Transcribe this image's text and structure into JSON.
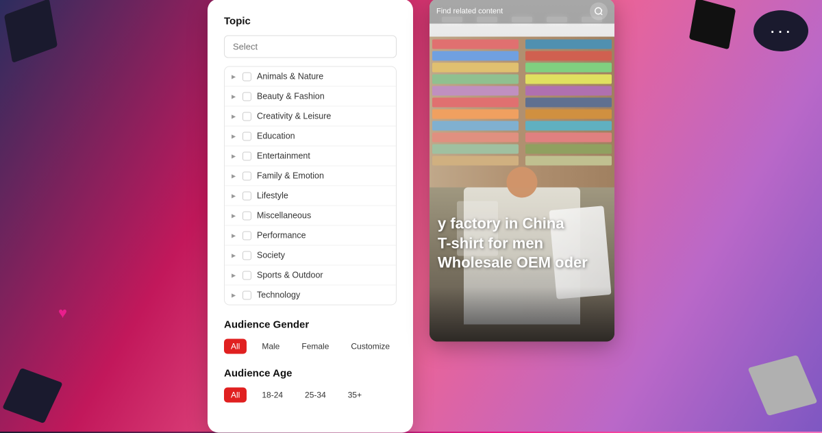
{
  "background": {
    "gradient": "linear-gradient(120deg, #2d2d5e, #c2185b, #f06292, #ba68c8, #7e57c2)"
  },
  "left_panel": {
    "topic_section": {
      "title": "Topic",
      "select_placeholder": "Select",
      "items": [
        {
          "label": "Animals & Nature",
          "checked": false
        },
        {
          "label": "Beauty & Fashion",
          "checked": false
        },
        {
          "label": "Creativity & Leisure",
          "checked": false
        },
        {
          "label": "Education",
          "checked": false
        },
        {
          "label": "Entertainment",
          "checked": false
        },
        {
          "label": "Family & Emotion",
          "checked": false
        },
        {
          "label": "Lifestyle",
          "checked": false
        },
        {
          "label": "Miscellaneous",
          "checked": false
        },
        {
          "label": "Performance",
          "checked": false
        },
        {
          "label": "Society",
          "checked": false
        },
        {
          "label": "Sports & Outdoor",
          "checked": false
        },
        {
          "label": "Technology",
          "checked": false
        }
      ]
    },
    "audience_gender": {
      "title": "Audience Gender",
      "buttons": [
        {
          "label": "All",
          "active": true
        },
        {
          "label": "Male",
          "active": false
        },
        {
          "label": "Female",
          "active": false
        },
        {
          "label": "Customize",
          "active": false
        }
      ]
    },
    "audience_age": {
      "title": "Audience Age",
      "buttons": [
        {
          "label": "All",
          "active": true
        },
        {
          "label": "18-24",
          "active": false
        },
        {
          "label": "25-34",
          "active": false
        },
        {
          "label": "35+",
          "active": false
        }
      ]
    }
  },
  "right_panel": {
    "top_bar": {
      "find_related_text": "Find related content"
    },
    "overlay_text": {
      "line1": "y factory in China",
      "line2": "T-shirt for men",
      "line3": "Wholesale OEM oder"
    }
  },
  "decorative": {
    "chat_icon": "···",
    "heart_icon": "♥"
  }
}
